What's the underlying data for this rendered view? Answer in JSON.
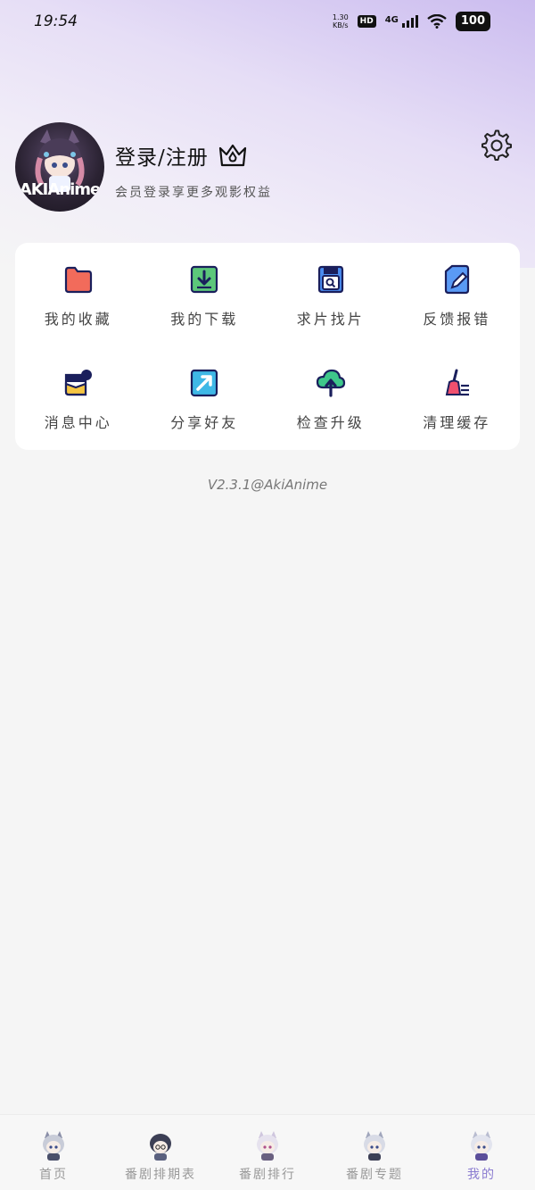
{
  "status_bar": {
    "time": "19:54",
    "net_speed_value": "1.30",
    "net_speed_unit": "KB/s",
    "hd": "HD",
    "network": "4G",
    "battery": "100"
  },
  "profile": {
    "avatar_text": "AKIAnime",
    "login_label": "登录/注册",
    "subtitle": "会员登录享更多观影权益"
  },
  "menu": {
    "items": [
      {
        "label": "我的收藏",
        "icon": "folder-icon",
        "color": "#f26b5b"
      },
      {
        "label": "我的下载",
        "icon": "download-icon",
        "color": "#5cc77a"
      },
      {
        "label": "求片找片",
        "icon": "search-file-icon",
        "color": "#4a8cf0"
      },
      {
        "label": "反馈报错",
        "icon": "edit-doc-icon",
        "color": "#5a9af5"
      },
      {
        "label": "消息中心",
        "icon": "message-icon",
        "color": "#f5c542"
      },
      {
        "label": "分享好友",
        "icon": "share-icon",
        "color": "#3fb8e6"
      },
      {
        "label": "检查升级",
        "icon": "cloud-upload-icon",
        "color": "#3ec78a"
      },
      {
        "label": "清理缓存",
        "icon": "broom-icon",
        "color": "#f0506e"
      }
    ]
  },
  "version": "V2.3.1@AkiAnime",
  "tabbar": {
    "tabs": [
      {
        "label": "首页"
      },
      {
        "label": "番剧排期表"
      },
      {
        "label": "番剧排行"
      },
      {
        "label": "番剧专题"
      },
      {
        "label": "我的"
      }
    ],
    "active_color": "#8a7bd0"
  }
}
